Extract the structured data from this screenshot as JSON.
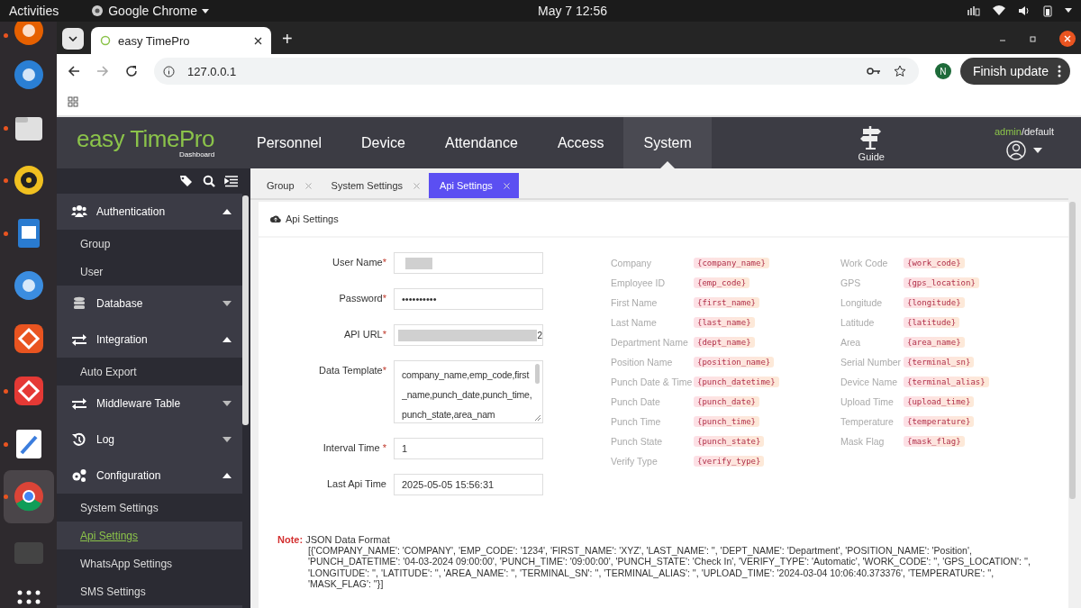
{
  "system_bar": {
    "activities": "Activities",
    "app": "Google Chrome",
    "clock": "May 7  12:56"
  },
  "dock": [
    {
      "kind": "firefox",
      "running": true,
      "selected": false
    },
    {
      "kind": "thunderbird",
      "running": false,
      "selected": false
    },
    {
      "kind": "files",
      "running": true,
      "selected": false
    },
    {
      "kind": "music",
      "running": true,
      "selected": false
    },
    {
      "kind": "writer",
      "running": true,
      "selected": false
    },
    {
      "kind": "help",
      "running": false,
      "selected": false
    },
    {
      "kind": "store",
      "running": false,
      "selected": false
    },
    {
      "kind": "remote",
      "running": true,
      "selected": false
    },
    {
      "kind": "editor",
      "running": true,
      "selected": false
    },
    {
      "kind": "chrome",
      "running": true,
      "selected": true
    },
    {
      "kind": "terminal",
      "running": false,
      "selected": false
    },
    {
      "kind": "apps",
      "running": false,
      "selected": false
    }
  ],
  "browser": {
    "tab_title": "easy TimePro",
    "new_tab": "+",
    "url": "127.0.0.1",
    "profile": "N",
    "update_button": "Finish update"
  },
  "app": {
    "logo": "easy TimePro",
    "logo_sub": "Dashboard",
    "nav": [
      {
        "label": "Personnel",
        "selected": false
      },
      {
        "label": "Device",
        "selected": false
      },
      {
        "label": "Attendance",
        "selected": false
      },
      {
        "label": "Access",
        "selected": false
      },
      {
        "label": "System",
        "selected": true
      }
    ],
    "guide": "Guide",
    "user": "admin",
    "user_suffix": "/default"
  },
  "sidebar": [
    {
      "label": "Authentication",
      "kind": "users",
      "expanded": true,
      "children": [
        {
          "label": "Group",
          "selected": false
        },
        {
          "label": "User",
          "selected": false
        }
      ]
    },
    {
      "label": "Database",
      "kind": "database",
      "expanded": false
    },
    {
      "label": "Integration",
      "kind": "arrows",
      "expanded": true,
      "children": [
        {
          "label": "Auto Export",
          "selected": false
        }
      ]
    },
    {
      "label": "Middleware Table",
      "kind": "arrows",
      "expanded": false
    },
    {
      "label": "Log",
      "kind": "history",
      "expanded": false
    },
    {
      "label": "Configuration",
      "kind": "gears",
      "expanded": true,
      "children": [
        {
          "label": "System Settings",
          "selected": false
        },
        {
          "label": "Api Settings",
          "selected": true
        },
        {
          "label": "WhatsApp Settings",
          "selected": false
        },
        {
          "label": "SMS Settings",
          "selected": false
        }
      ]
    }
  ],
  "tabs": [
    {
      "label": "Group",
      "selected": false
    },
    {
      "label": "System Settings",
      "selected": false
    },
    {
      "label": "Api Settings",
      "selected": true
    }
  ],
  "panel_title": "Api Settings",
  "form": [
    {
      "label": "User Name",
      "required_mark": "*",
      "kind": "redacted"
    },
    {
      "label": "Password",
      "required_mark": "*",
      "kind": "text",
      "value": "••••••••••"
    },
    {
      "label": "API URL",
      "required_mark": "*",
      "kind": "redacted",
      "value": "2"
    },
    {
      "label": "Data Template",
      "required_mark": "*",
      "kind": "textarea",
      "value": "company_name,emp_code,first_name,punch_date,punch_time,punch_state,area_nam"
    },
    {
      "label": "Interval Time ",
      "required_mark": "*",
      "kind": "text",
      "value": "1"
    },
    {
      "label": "Last Api Time",
      "kind": "text",
      "value": "2025-05-05 15:56:31"
    }
  ],
  "variables": [
    [
      {
        "label": "Company",
        "code": "{company_name}"
      },
      {
        "label": "Employee ID",
        "code": "{emp_code}"
      },
      {
        "label": "First Name",
        "code": "{first_name}"
      },
      {
        "label": "Last Name",
        "code": "{last_name}"
      },
      {
        "label": "Department Name",
        "code": "{dept_name}"
      },
      {
        "label": "Position Name",
        "code": "{position_name}"
      },
      {
        "label": "Punch Date & Time",
        "code": "{punch_datetime}"
      },
      {
        "label": "Punch Date",
        "code": "{punch_date}"
      },
      {
        "label": "Punch Time",
        "code": "{punch_time}"
      },
      {
        "label": "Punch State",
        "code": "{punch_state}"
      },
      {
        "label": "Verify Type",
        "code": "{verify_type}"
      }
    ],
    [
      {
        "label": "Work Code",
        "code": "{work_code}"
      },
      {
        "label": "GPS",
        "code": "{gps_location}"
      },
      {
        "label": "Longitude",
        "code": "{longitude}"
      },
      {
        "label": "Latitude",
        "code": "{latitude}"
      },
      {
        "label": "Area",
        "code": "{area_name}"
      },
      {
        "label": "Serial Number",
        "code": "{terminal_sn}"
      },
      {
        "label": "Device Name",
        "code": "{terminal_alias}"
      },
      {
        "label": "Upload Time",
        "code": "{upload_time}"
      },
      {
        "label": "Temperature",
        "code": "{temperature}"
      },
      {
        "label": "Mask Flag",
        "code": "{mask_flag}"
      }
    ]
  ],
  "note": {
    "label": "Note:",
    "title": "JSON Data Format",
    "lines": [
      "[{'COMPANY_NAME': 'COMPANY', 'EMP_CODE': '1234', 'FIRST_NAME': 'XYZ', 'LAST_NAME': '', 'DEPT_NAME': 'Department', 'POSITION_NAME': 'Position',",
      "'PUNCH_DATETIME': '04-03-2024 09:00:00', 'PUNCH_TIME': '09:00:00', 'PUNCH_STATE': 'Check In', 'VERIFY_TYPE': 'Automatic', 'WORK_CODE': '', 'GPS_LOCATION': '',",
      "'LONGITUDE': '', 'LATITUDE': '', 'AREA_NAME': '', 'TERMINAL_SN': '', 'TERMINAL_ALIAS': '', 'UPLOAD_TIME': '2024-03-04 10:06:40.373376', 'TEMPERATURE': '',",
      "'MASK_FLAG': ''}]"
    ]
  }
}
